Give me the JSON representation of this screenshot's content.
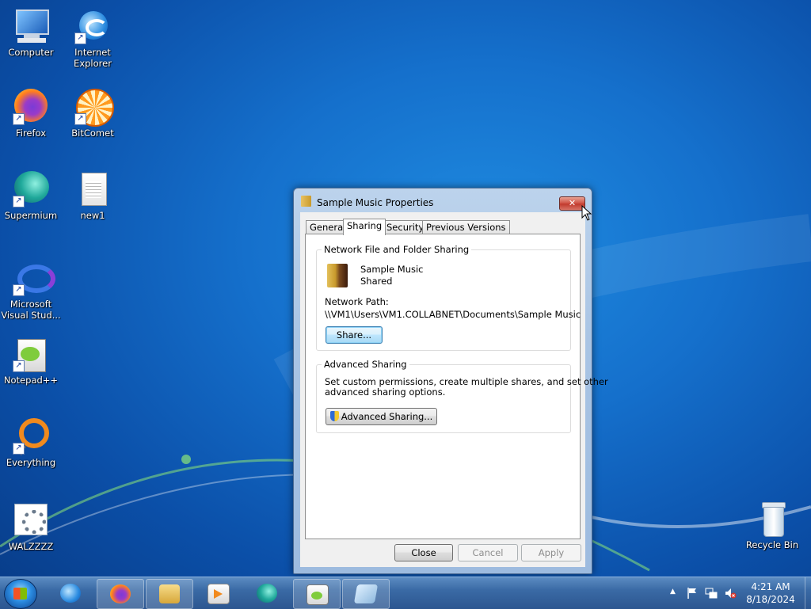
{
  "desktop": {
    "icons": [
      {
        "label": "Computer",
        "icon": "computer-icon"
      },
      {
        "label": "Internet Explorer",
        "icon": "internet-explorer-icon"
      },
      {
        "label": "Firefox",
        "icon": "firefox-icon"
      },
      {
        "label": "BitComet",
        "icon": "bitcomet-icon"
      },
      {
        "label": "Supermium",
        "icon": "supermium-icon"
      },
      {
        "label": "new1",
        "icon": "text-file-icon"
      },
      {
        "label": "Microsoft Visual Stud...",
        "icon": "visual-studio-icon"
      },
      {
        "label": "Notepad++",
        "icon": "notepad-plus-plus-icon"
      },
      {
        "label": "Everything",
        "icon": "everything-search-icon"
      },
      {
        "label": "WALZZZZ",
        "icon": "settings-gear-icon"
      },
      {
        "label": "Recycle Bin",
        "icon": "recycle-bin-icon"
      }
    ]
  },
  "window": {
    "title": "Sample Music Properties",
    "close_glyph": "✕",
    "tabs": [
      "General",
      "Sharing",
      "Security",
      "Previous Versions"
    ],
    "active_tab": "Sharing",
    "network_sharing": {
      "group_title": "Network File and Folder Sharing",
      "folder_name": "Sample Music",
      "status": "Shared",
      "path_label": "Network Path:",
      "path": "\\\\VM1\\Users\\VM1.COLLABNET\\Documents\\Sample Music",
      "share_button": "Share..."
    },
    "advanced_sharing": {
      "group_title": "Advanced Sharing",
      "description_line1": "Set custom permissions, create multiple shares, and set other",
      "description_line2": "advanced sharing options.",
      "button": "Advanced Sharing..."
    },
    "buttons": {
      "close": "Close",
      "cancel": "Cancel",
      "apply": "Apply"
    }
  },
  "taskbar": {
    "items": [
      "internet-explorer-icon",
      "firefox-icon",
      "windows-explorer-icon",
      "media-player-icon",
      "supermium-icon",
      "notepad-plus-plus-icon",
      "notepad-window-icon"
    ],
    "clock": {
      "time": "4:21 AM",
      "date": "8/18/2024"
    },
    "tray_icons": [
      "show-hidden-icons-arrow",
      "action-center-flag-icon",
      "network-icon",
      "volume-muted-icon"
    ]
  },
  "colors": {
    "desktop": "#1570cc",
    "taskbar": "#3a6aa5",
    "close_button": "#c13b2e"
  }
}
